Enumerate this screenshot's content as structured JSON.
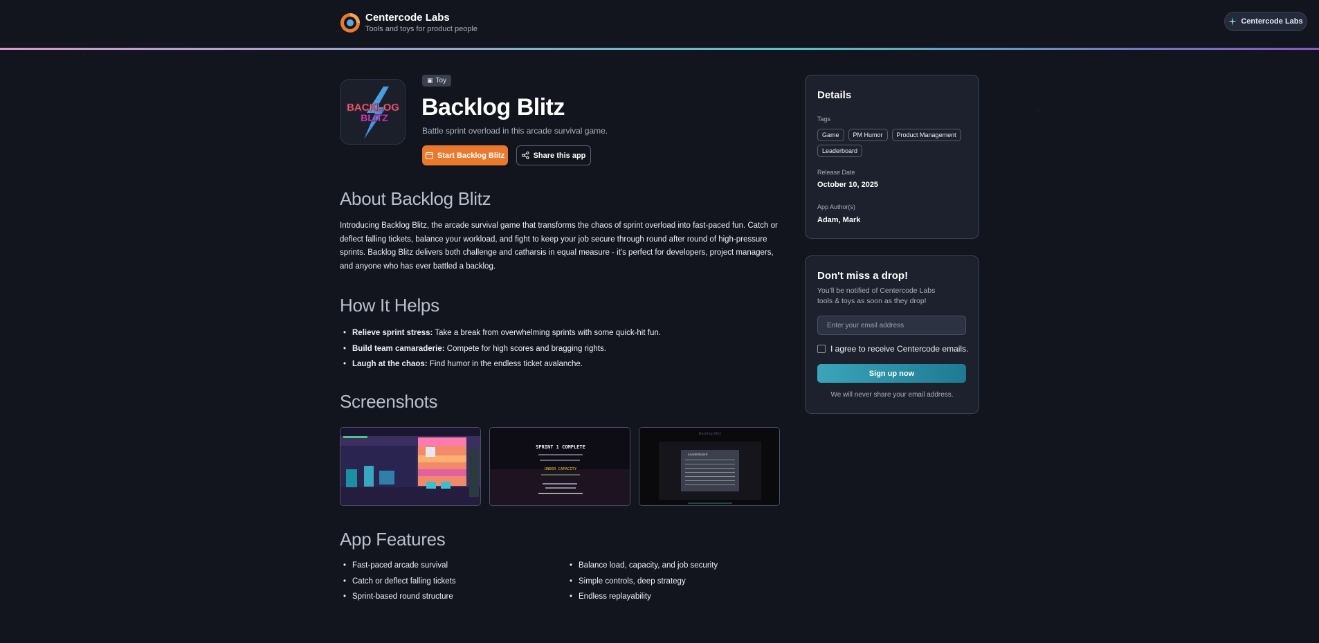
{
  "header": {
    "brand_name": "Centercode Labs",
    "brand_tagline": "Tools and toys for product people",
    "pill_label": "Centercode Labs"
  },
  "app": {
    "badge": "Toy",
    "title": "Backlog Blitz",
    "subtitle": "Battle sprint overload in this arcade survival game.",
    "start_button": "Start Backlog Blitz",
    "share_button": "Share this app",
    "icon_logo_text": [
      "BACKLOG",
      "BLITZ"
    ]
  },
  "about": {
    "heading": "About Backlog Blitz",
    "text": "Introducing Backlog Blitz, the arcade survival game that transforms the chaos of sprint overload into fast-paced fun. Catch or deflect falling tickets, balance your workload, and fight to keep your job secure through round after round of high-pressure sprints. Backlog Blitz delivers both challenge and catharsis in equal measure - it's perfect for developers, project managers, and anyone who has ever battled a backlog."
  },
  "helps": {
    "heading": "How It Helps",
    "items": [
      {
        "bold": "Relieve sprint stress:",
        "text": " Take a break from overwhelming sprints with some quick-hit fun."
      },
      {
        "bold": "Build team camaraderie:",
        "text": " Compete for high scores and bragging rights."
      },
      {
        "bold": "Laugh at the chaos:",
        "text": " Find humor in the endless ticket avalanche."
      }
    ]
  },
  "screenshots": {
    "heading": "Screenshots",
    "shot2_title": "SPRINT 1 COMPLETE",
    "shot2_status": "UNDER CAPACITY",
    "shot3_title": "Backlog Blitz",
    "shot3_panel": "Leaderboard"
  },
  "features": {
    "heading": "App Features",
    "col1": [
      "Fast-paced arcade survival",
      "Catch or deflect falling tickets",
      "Sprint-based round structure"
    ],
    "col2": [
      "Balance load, capacity, and job security",
      "Simple controls, deep strategy",
      "Endless replayability"
    ]
  },
  "details": {
    "title": "Details",
    "tags_label": "Tags",
    "tags": [
      "Game",
      "PM Humor",
      "Product Management",
      "Leaderboard"
    ],
    "release_label": "Release Date",
    "release_value": "October 10, 2025",
    "author_label": "App Author(s)",
    "author_value": "Adam, Mark"
  },
  "signup": {
    "title": "Don't miss a drop!",
    "description": "You'll be notified of Centercode Labs tools & toys as soon as they drop!",
    "email_placeholder": "Enter your email address",
    "agree_label": "I agree to receive Centercode emails.",
    "button": "Sign up now",
    "note": "We will never share your email address."
  },
  "colors": {
    "background": "#12151d",
    "accent_orange": "#e9792d",
    "accent_teal": "#3aa5b8",
    "card": "#1c212d"
  }
}
